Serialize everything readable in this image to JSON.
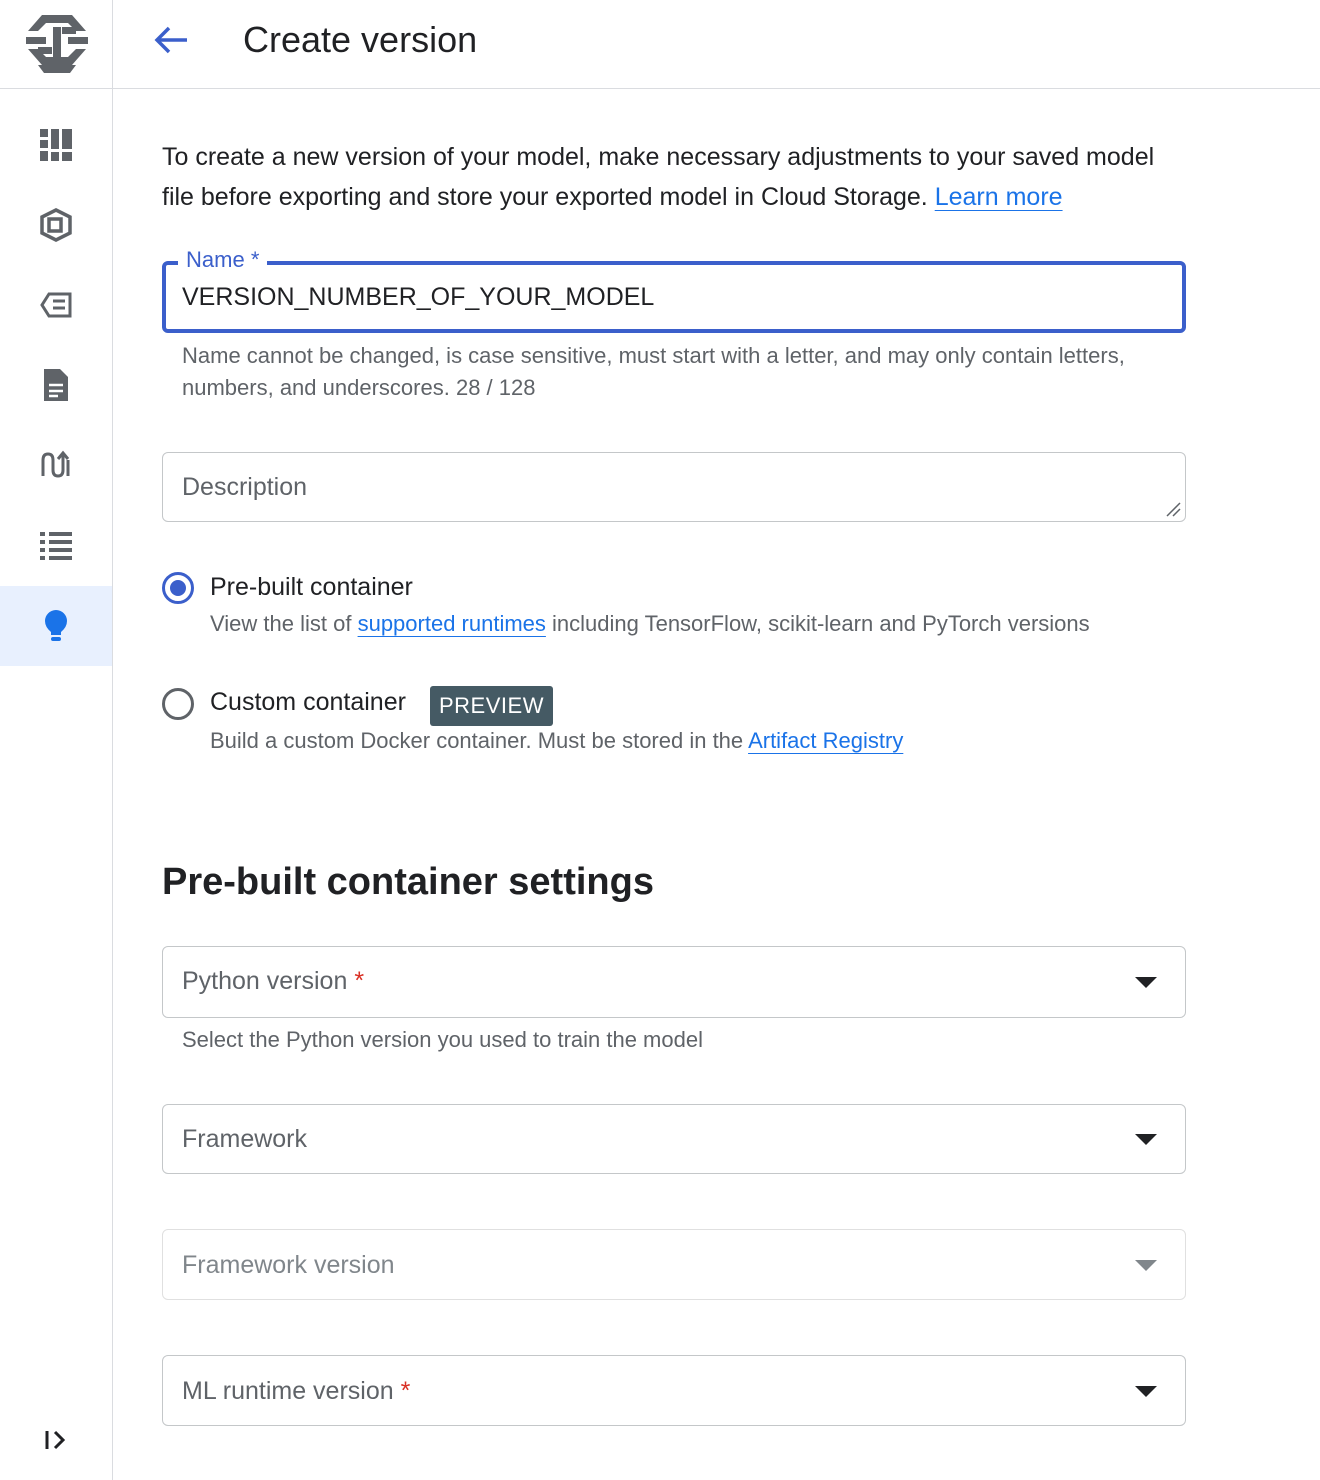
{
  "header": {
    "title": "Create version"
  },
  "rail": {
    "items": [
      {
        "icon": "dashboard-icon"
      },
      {
        "icon": "datasets-icon"
      },
      {
        "icon": "features-icon"
      },
      {
        "icon": "document-icon"
      },
      {
        "icon": "pipelines-icon"
      },
      {
        "icon": "list-icon"
      },
      {
        "icon": "lightbulb-icon",
        "active": true
      }
    ]
  },
  "intro": {
    "text": "To create a new version of your model, make necessary adjustments to your saved model file before exporting and store your exported model in Cloud Storage.",
    "link": "Learn more"
  },
  "name_field": {
    "label": "Name",
    "required_mark": "*",
    "value": "VERSION_NUMBER_OF_YOUR_MODEL",
    "helper": "Name cannot be changed, is case sensitive, must start with a letter, and may only contain letters, numbers, and underscores.",
    "counter": "28 / 128"
  },
  "description_field": {
    "placeholder": "Description"
  },
  "container_options": {
    "prebuilt": {
      "label": "Pre-built container",
      "desc_before": "View the list of",
      "desc_link": "supported runtimes",
      "desc_after": "including TensorFlow, scikit-learn and PyTorch versions",
      "selected": true
    },
    "custom": {
      "label": "Custom container",
      "badge": "PREVIEW",
      "desc_before": "Build a custom Docker container. Must be stored in the",
      "desc_link": "Artifact Registry",
      "selected": false
    }
  },
  "settings": {
    "title": "Pre-built container settings",
    "python_version": {
      "label": "Python version",
      "required_mark": "*",
      "helper": "Select the Python version you used to train the model"
    },
    "framework": {
      "label": "Framework"
    },
    "framework_version": {
      "label": "Framework version",
      "disabled": true
    },
    "ml_runtime_version": {
      "label": "ML runtime version",
      "required_mark": "*"
    }
  },
  "colors": {
    "accent": "#3b5fcb",
    "link": "#1a73e8",
    "required": "#d93025",
    "badge_bg": "#455a64",
    "active_rail_bg": "#e8f0fe"
  }
}
